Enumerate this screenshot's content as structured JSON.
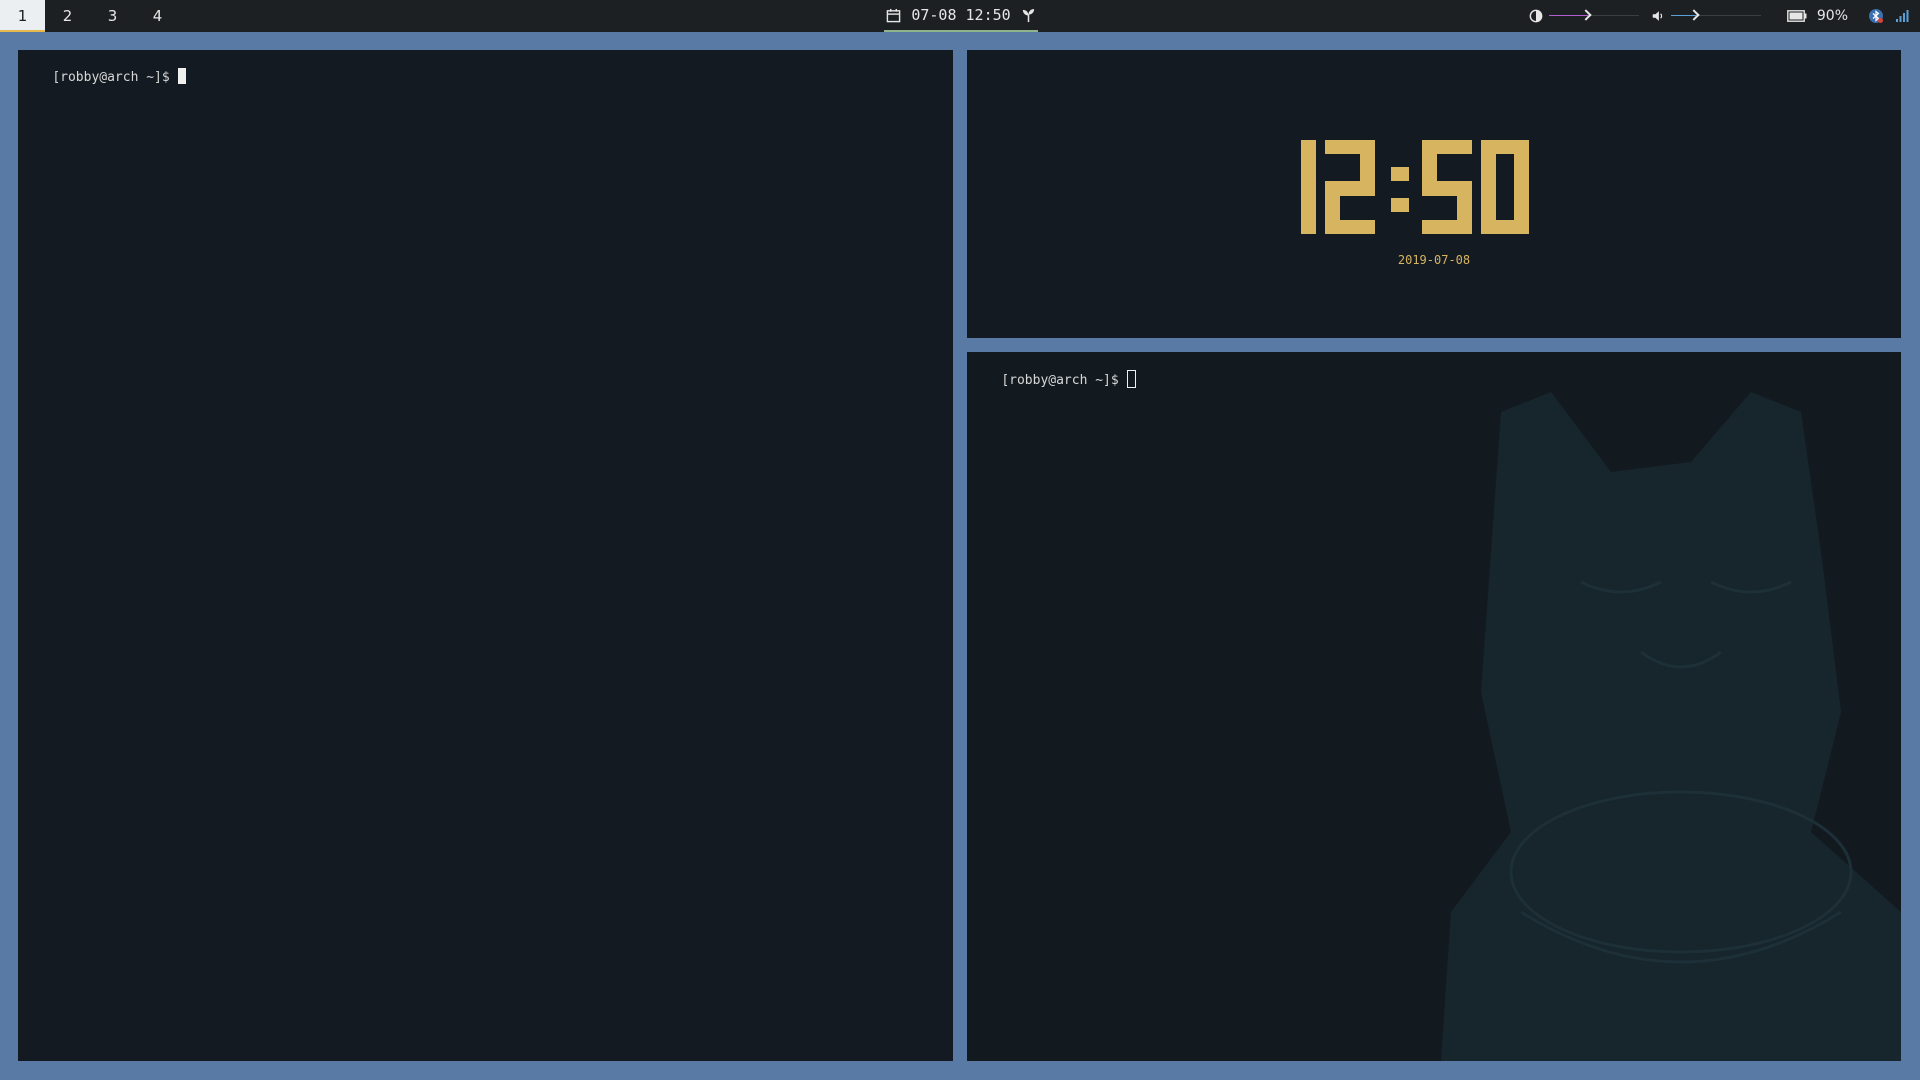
{
  "colors": {
    "accent_workspace": "#e5b94e",
    "accent_clock": "#8fb48c",
    "brightness_slider": "#b35fd1",
    "volume_slider": "#5aa0d8",
    "clock_digits": "#d6b460",
    "terminal_bg": "#131a21",
    "desktop_bg": "#5a7aa6"
  },
  "bar": {
    "workspaces": [
      {
        "label": "1",
        "active": true
      },
      {
        "label": "2",
        "active": false
      },
      {
        "label": "3",
        "active": false
      },
      {
        "label": "4",
        "active": false
      }
    ],
    "clock": {
      "icon": "calendar-icon",
      "text": "07-08 12:50",
      "trail_icon": "sprout-icon"
    },
    "brightness": {
      "icon": "brightness-icon",
      "level": 0.43
    },
    "volume": {
      "icon": "volume-icon",
      "level": 0.28
    },
    "battery": {
      "icon": "battery-icon",
      "text": "90%"
    },
    "tray": [
      "bluetooth-icon",
      "network-signal-icon"
    ]
  },
  "terminal_left": {
    "prompt": "[robby@arch ~]$"
  },
  "clock_pane": {
    "time": "12:50",
    "date": "2019-07-08"
  },
  "terminal_right": {
    "prompt": "[robby@arch ~]$"
  }
}
